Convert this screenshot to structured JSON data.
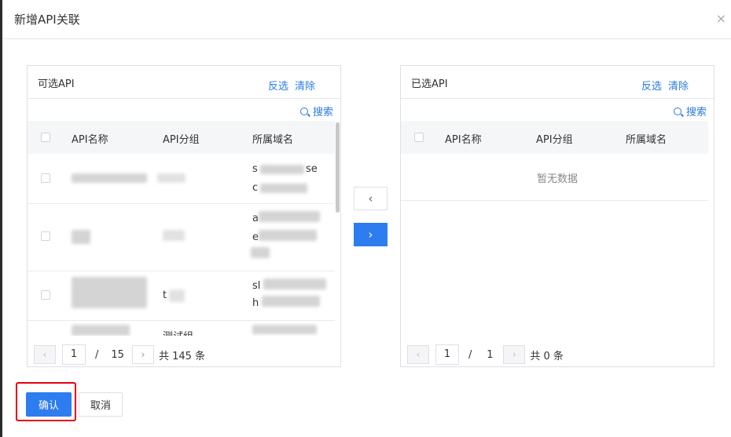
{
  "dialog": {
    "title": "新增API关联",
    "close_symbol": "×"
  },
  "available": {
    "title": "可选API",
    "invert_label": "反选",
    "clear_label": "清除",
    "search_label": "搜索",
    "columns": [
      "API名称",
      "API分组",
      "所属域名"
    ],
    "rows": [
      {
        "domain_line1": "s",
        "domain_line1_end": "se",
        "domain_line2": "c"
      },
      {
        "domain_line1": "a",
        "domain_line2": "e"
      },
      {
        "group": "t",
        "domain_line1": "sl",
        "domain_line2": "h"
      },
      {
        "group": "测试组"
      }
    ],
    "pager": {
      "current_page": "1",
      "separator": "/",
      "total_pages": "15",
      "total_text": "共 145 条"
    }
  },
  "selected": {
    "title": "已选API",
    "invert_label": "反选",
    "clear_label": "清除",
    "search_label": "搜索",
    "columns": [
      "API名称",
      "API分组",
      "所属域名"
    ],
    "empty_text": "暂无数据",
    "pager": {
      "current_page": "1",
      "separator": "/",
      "total_pages": "1",
      "total_text": "共 0 条"
    }
  },
  "transfer": {
    "back_symbol": "‹",
    "forward_symbol": "›"
  },
  "footer": {
    "confirm_label": "确认",
    "cancel_label": "取消"
  },
  "colors": {
    "primary": "#2d7cf0",
    "link": "#2a7be4",
    "highlight": "#e60012"
  }
}
